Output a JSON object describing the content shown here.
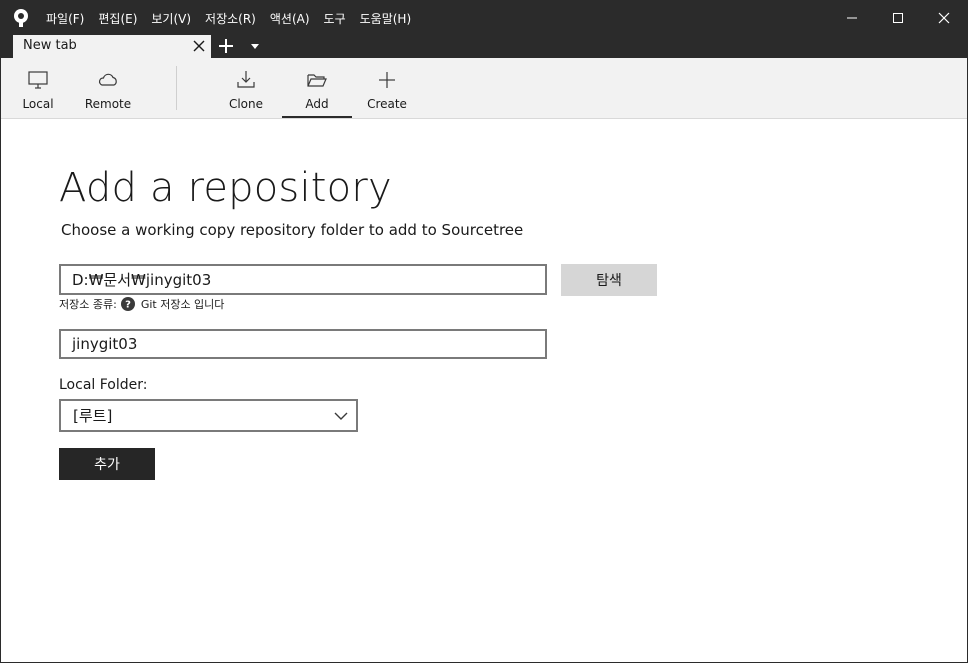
{
  "menu": [
    "파일(F)",
    "편집(E)",
    "보기(V)",
    "저장소(R)",
    "액션(A)",
    "도구",
    "도움말(H)"
  ],
  "tab": {
    "label": "New tab"
  },
  "toolbar": {
    "local": "Local",
    "remote": "Remote",
    "clone": "Clone",
    "add": "Add",
    "create": "Create",
    "active": "Add"
  },
  "page": {
    "title": "Add a repository",
    "subtitle": "Choose a working copy repository folder to add to Sourcetree"
  },
  "form": {
    "path_value": "D:₩문서₩jinygit03",
    "browse_label": "탐색",
    "repo_type_label": "저장소 종류:",
    "repo_type_value": "Git 저장소 입니다",
    "name_value": "jinygit03",
    "local_folder_label": "Local Folder:",
    "local_folder_value": "[루트]",
    "submit_label": "추가"
  },
  "colors": {
    "titlebar": "#2b2b2b",
    "toolbar": "#f2f2f2",
    "primary_button": "#262626",
    "secondary_button": "#d6d6d6"
  },
  "icons": {
    "app": "sourcetree-logo-icon",
    "local": "monitor-icon",
    "remote": "cloud-icon",
    "clone": "download-icon",
    "add": "folder-open-icon",
    "create": "plus-icon",
    "help": "question-circle-icon",
    "dropdown": "chevron-down-icon"
  }
}
